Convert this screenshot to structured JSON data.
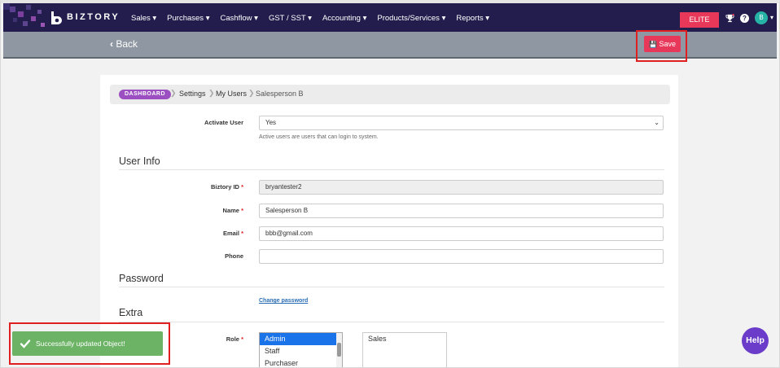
{
  "brand": {
    "name": "BIZTORY"
  },
  "nav": {
    "menu": [
      "Sales ▾",
      "Purchases ▾",
      "Cashflow ▾",
      "GST / SST ▾",
      "Accounting ▾",
      "Products/Services ▾",
      "Reports ▾"
    ],
    "plan_badge": "ELITE",
    "avatar_initial": "B"
  },
  "toolbar": {
    "back_label": "Back",
    "save_label": "Save"
  },
  "breadcrumb": {
    "dashboard": "DASHBOARD",
    "items": [
      "Settings",
      "My Users",
      "Salesperson B"
    ]
  },
  "form": {
    "activate_user": {
      "label": "Activate User",
      "value": "Yes",
      "hint": "Active users are users that can login to system."
    },
    "user_info_heading": "User Info",
    "biztory_id": {
      "label": "Biztory ID",
      "required": "*",
      "value": "bryantester2"
    },
    "name": {
      "label": "Name",
      "required": "*",
      "value": "Salesperson B"
    },
    "email": {
      "label": "Email",
      "required": "*",
      "value": "bbb@gmail.com"
    },
    "phone": {
      "label": "Phone",
      "value": ""
    },
    "password_heading": "Password",
    "change_password_link": "Change password",
    "extra_heading": "Extra",
    "role": {
      "label": "Role",
      "required": "*",
      "available": [
        "Admin",
        "Staff",
        "Purchaser"
      ],
      "selected_option": "Admin",
      "assigned": [
        "Sales"
      ]
    }
  },
  "toast": {
    "message": "Successfully updated Object!"
  },
  "help_button": "Help",
  "colors": {
    "navbar": "#231d4d",
    "accent": "#e8385a",
    "toast": "#6cb366",
    "help": "#6a3cc9",
    "dashboard_badge": "#9b4fc0",
    "highlight_box": "#e02020"
  }
}
